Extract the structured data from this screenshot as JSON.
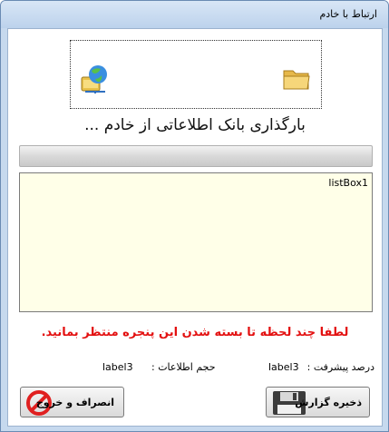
{
  "window": {
    "title": "ارتباط با خادم"
  },
  "main": {
    "loading_text": "بارگذاری بانک اطلاعاتی از خادم ...",
    "progress_fraction": 0.0,
    "listbox_label": "listBox1",
    "warning_text": "لطفا چند لحظه تا بسته شدن این پنجره منتظر بمانید."
  },
  "stats": {
    "progress_label": "درصد پیشرفت :",
    "progress_value": "label3",
    "size_label": "حجم اطلاعات :",
    "size_value": "label3"
  },
  "buttons": {
    "save_report": "ذخیره گزارش",
    "cancel_exit": "انصراف و خروج"
  },
  "colors": {
    "warning": "#e31010",
    "listbox_bg": "#ffffe8"
  },
  "icons": [
    "network-drive-icon",
    "folder-icon",
    "floppy-disk-icon",
    "cancel-icon"
  ]
}
